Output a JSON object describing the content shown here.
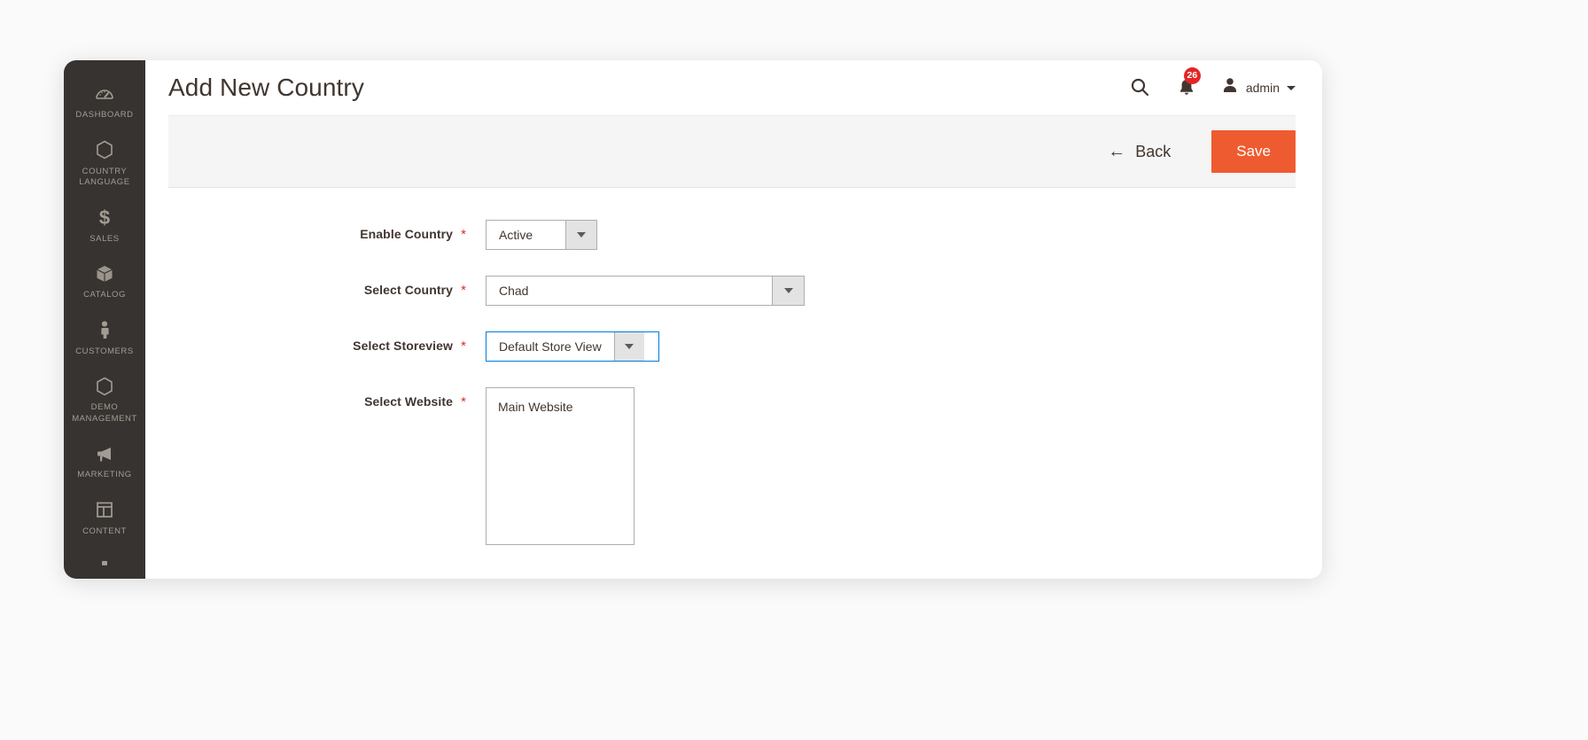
{
  "header": {
    "title": "Add New Country",
    "search_icon": "search-icon",
    "notifications_icon": "bell-icon",
    "notifications_count": "26",
    "account_icon": "user-avatar-icon",
    "account_name": "admin",
    "account_caret": "chevron-down-icon"
  },
  "sidebar": {
    "items": [
      {
        "label": "DASHBOARD",
        "icon": "dashboard-gauge-icon"
      },
      {
        "label": "COUNTRY LANGUAGE",
        "icon": "hexagon-icon"
      },
      {
        "label": "SALES",
        "icon": "dollar-sign-icon"
      },
      {
        "label": "CATALOG",
        "icon": "box-icon"
      },
      {
        "label": "CUSTOMERS",
        "icon": "person-icon"
      },
      {
        "label": "DEMO MANAGEMENT",
        "icon": "hexagon-icon"
      },
      {
        "label": "MARKETING",
        "icon": "megaphone-icon"
      },
      {
        "label": "CONTENT",
        "icon": "layout-panels-icon"
      },
      {
        "label": "",
        "icon": "partial-icon"
      }
    ]
  },
  "toolbar": {
    "back_label": "Back",
    "back_icon": "arrow-left-icon",
    "save_label": "Save",
    "save_color": "#ef5b30"
  },
  "form": {
    "required_marker": "*",
    "rows": [
      {
        "label": "Enable Country",
        "control": "select",
        "value": "Active",
        "required": true,
        "focused": false
      },
      {
        "label": "Select Country",
        "control": "select",
        "value": "Chad",
        "required": true,
        "focused": false
      },
      {
        "label": "Select Storeview",
        "control": "select",
        "value": "Default Store View",
        "required": true,
        "focused": true
      },
      {
        "label": "Select Website",
        "control": "multiselect",
        "value": "Main Website",
        "required": true,
        "focused": false
      }
    ]
  },
  "colors": {
    "accent": "#ef5b30",
    "sidebar_bg": "#373330",
    "required_red": "#e02b27",
    "focus_blue": "#007bdb",
    "badge_red": "#e22626"
  }
}
